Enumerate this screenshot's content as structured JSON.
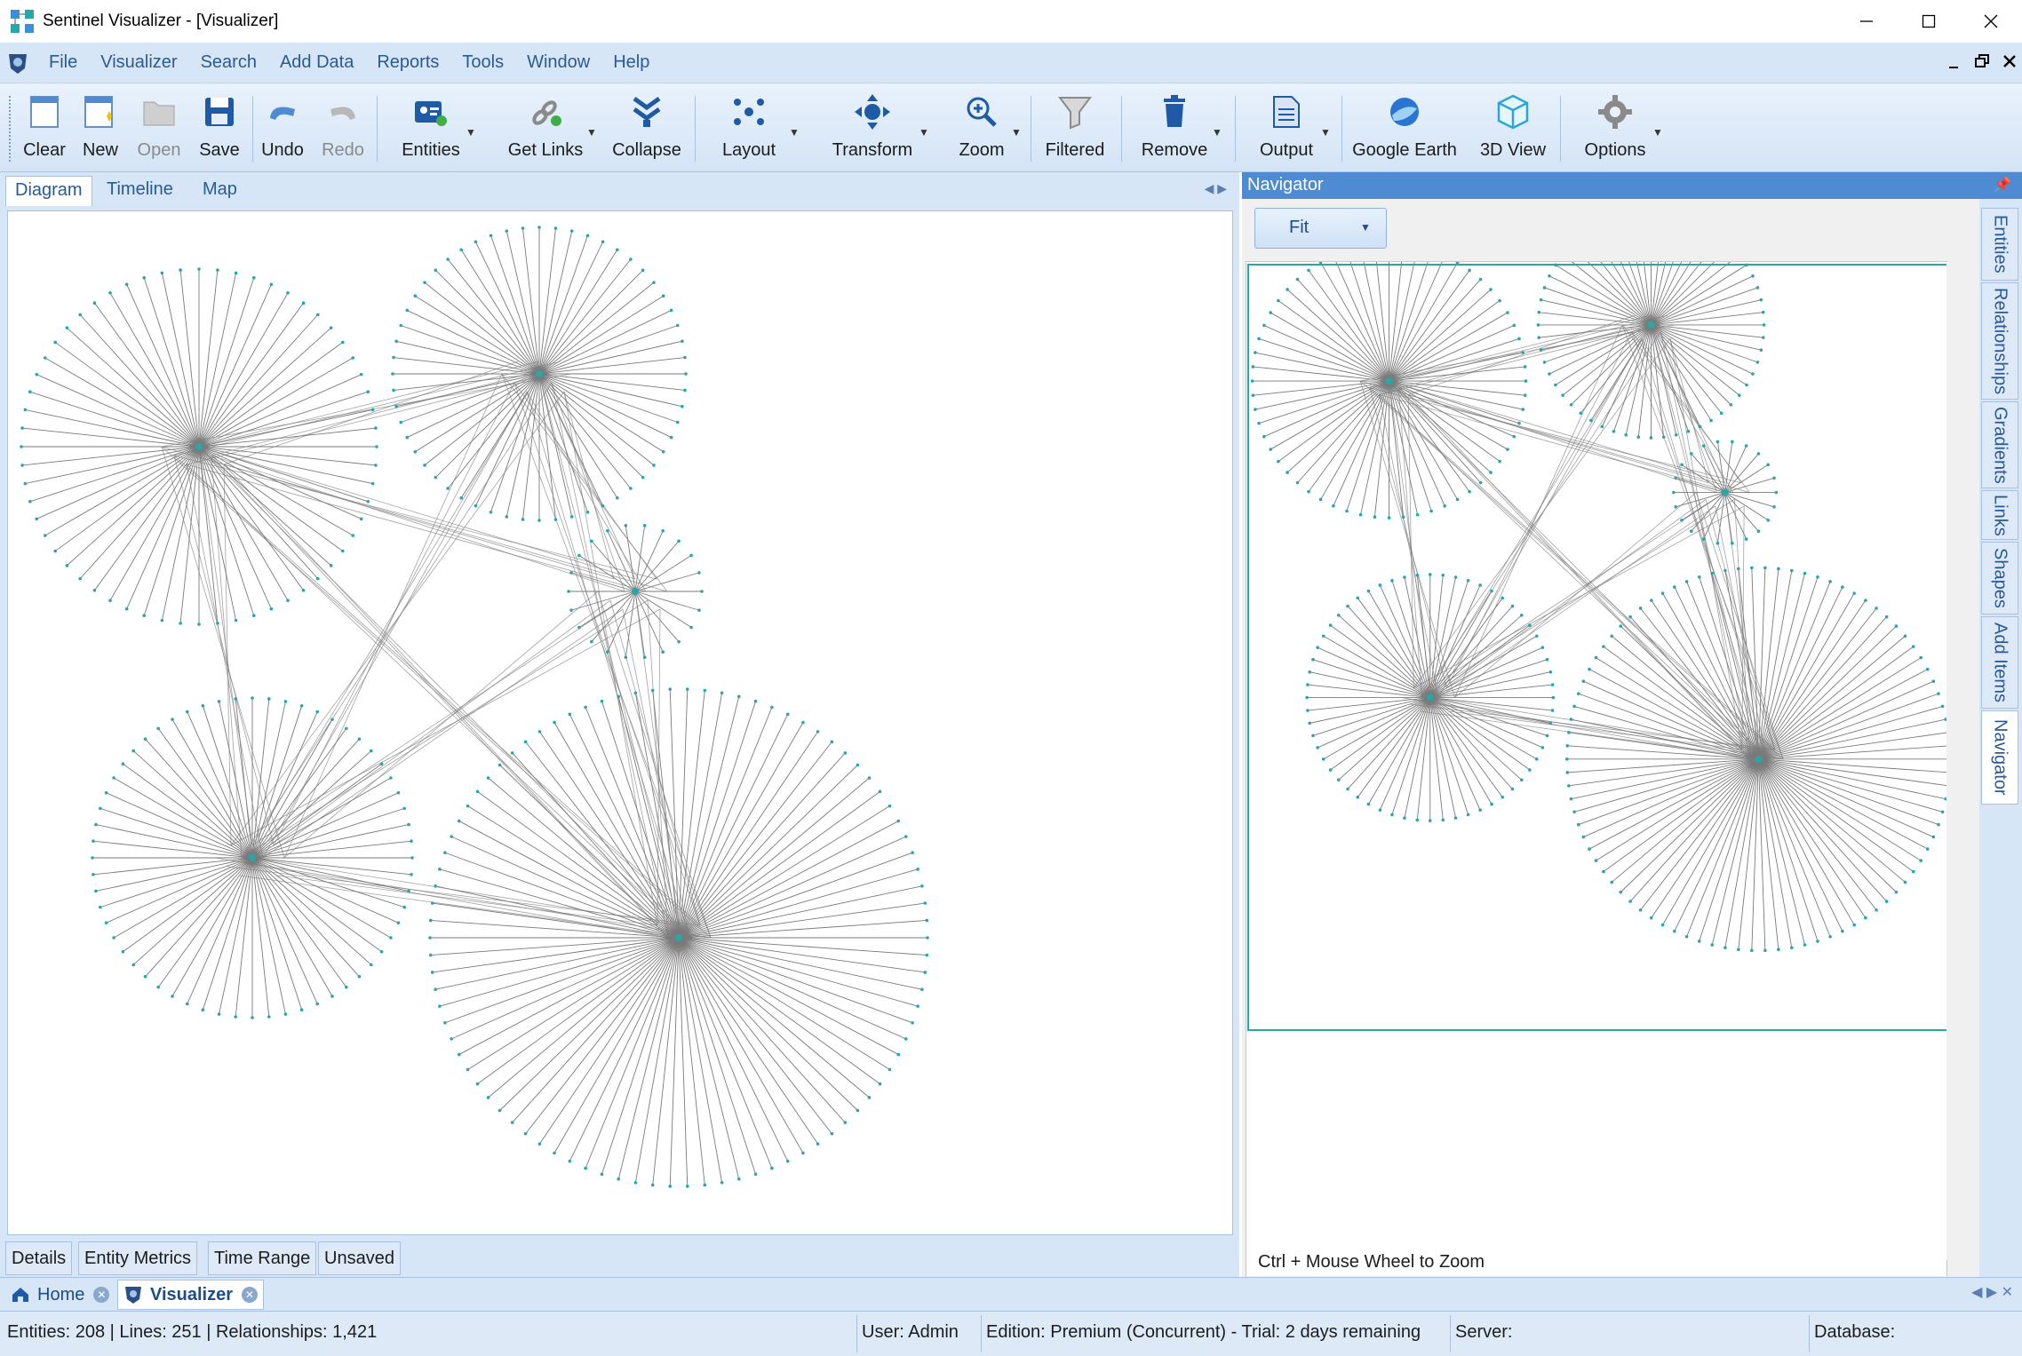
{
  "window": {
    "title": "Sentinel Visualizer - [Visualizer]"
  },
  "menu": [
    "File",
    "Visualizer",
    "Search",
    "Add Data",
    "Reports",
    "Tools",
    "Window",
    "Help"
  ],
  "toolbar": {
    "clear": "Clear",
    "new": "New",
    "open": "Open",
    "save": "Save",
    "undo": "Undo",
    "redo": "Redo",
    "entities": "Entities",
    "get_links": "Get Links",
    "collapse": "Collapse",
    "layout": "Layout",
    "transform": "Transform",
    "zoom": "Zoom",
    "filtered": "Filtered",
    "remove": "Remove",
    "output": "Output",
    "google_earth": "Google Earth",
    "view3d": "3D View",
    "options": "Options"
  },
  "doc_tabs": [
    "Diagram",
    "Timeline",
    "Map"
  ],
  "bottom_tabs": [
    "Details",
    "Entity Metrics",
    "Time Range",
    "Unsaved"
  ],
  "navigator": {
    "title": "Navigator",
    "fit_label": "Fit",
    "hint": "Ctrl + Mouse Wheel to Zoom"
  },
  "side_tabs": [
    "Entities",
    "Relationships",
    "Gradients",
    "Links",
    "Shapes",
    "Add Items",
    "Navigator"
  ],
  "window_tabs": [
    "Home",
    "Visualizer"
  ],
  "status": {
    "counts": "Entities: 208 | Lines: 251 | Relationships: 1,421",
    "user": "User:  Admin",
    "edition": "Edition: Premium (Concurrent) - Trial: 2 days remaining",
    "server": "Server:",
    "database": "Database:"
  },
  "colors": {
    "accent": "#4f8bd2",
    "chrome": "#d6e6f7",
    "link": "#7a7a7a",
    "node": "#2aa6a6"
  }
}
